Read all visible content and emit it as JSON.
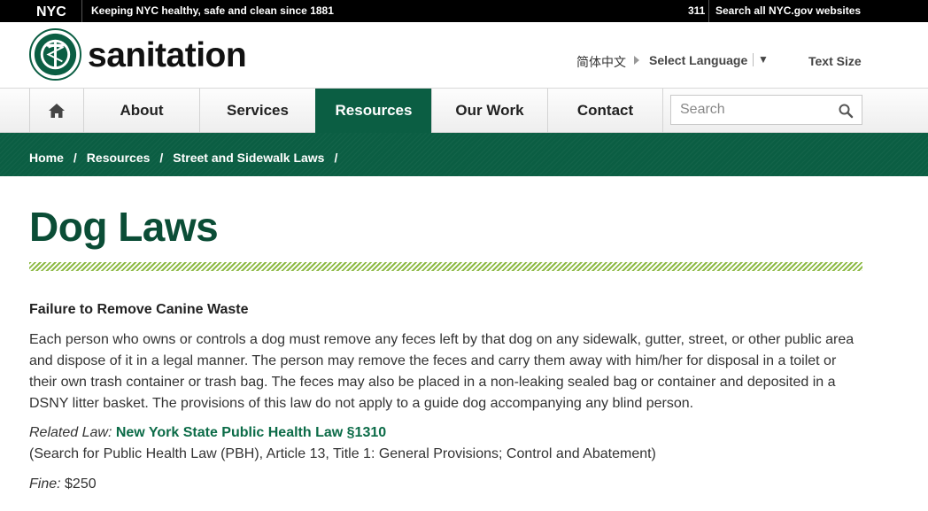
{
  "topbar": {
    "logo_text": "NYC",
    "tagline": "Keeping NYC healthy, safe and clean since 1881",
    "link_311": "311",
    "search_all": "Search all NYC.gov websites"
  },
  "header": {
    "brand": "sanitation",
    "language_chinese": "简体中文",
    "select_language": "Select Language",
    "select_caret": "▼",
    "text_size": "Text Size"
  },
  "nav": {
    "items": [
      {
        "label": "About"
      },
      {
        "label": "Services"
      },
      {
        "label": "Resources"
      },
      {
        "label": "Our Work"
      },
      {
        "label": "Contact"
      }
    ],
    "search_placeholder": "Search"
  },
  "breadcrumb": {
    "items": [
      "Home",
      "Resources",
      "Street and Sidewalk Laws"
    ],
    "separator": "/"
  },
  "main": {
    "title": "Dog Laws",
    "section_heading": "Failure to Remove Canine Waste",
    "body": "Each person who owns or controls a dog must remove any feces left by that dog on any sidewalk, gutter, street, or other public area and dispose of it in a legal manner.  The person may remove the feces and carry them away with him/her for disposal in a toilet or their own trash container or trash bag.  The feces may also be placed in a non-leaking sealed bag or container and deposited in a DSNY litter basket.  The provisions of this law do not apply to a guide dog accompanying any blind person.",
    "related_label": "Related Law:",
    "related_link": "New York State Public Health Law §1310",
    "related_note": "(Search for Public Health Law (PBH), Article 13, Title 1: General Provisions; Control and Abatement)",
    "fine_label": "Fine:",
    "fine_value": "$250"
  },
  "colors": {
    "brand_green": "#0b5e43",
    "title_green": "#0b4d36",
    "stripe_green": "#8dba45"
  }
}
